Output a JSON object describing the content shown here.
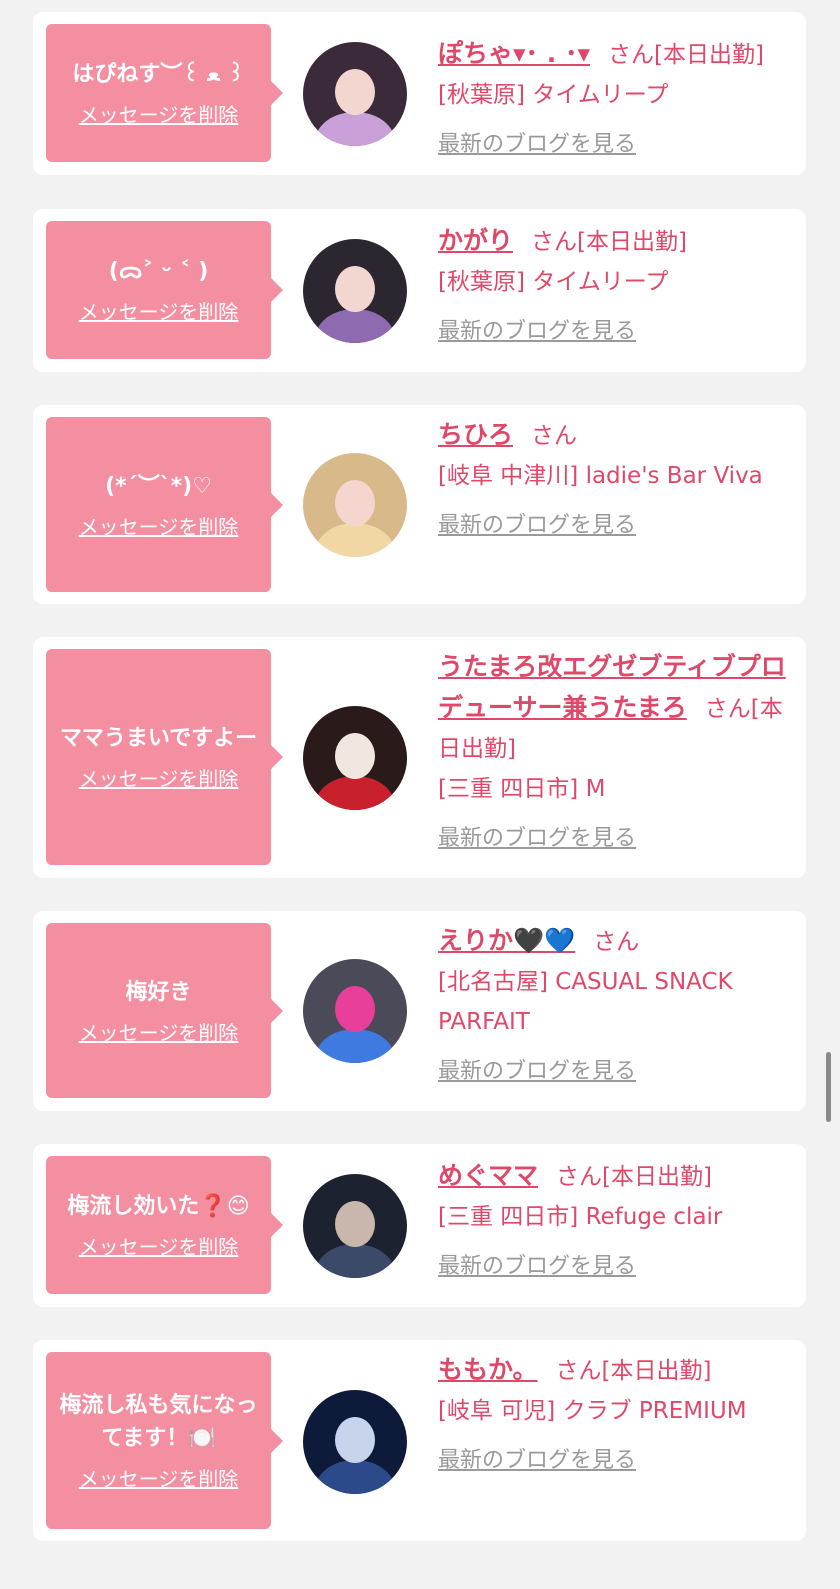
{
  "colors": {
    "page_background": "#f2f2f2",
    "card_background": "#ffffff",
    "bubble": "#f48fa1",
    "accent_text": "#e0486a",
    "blog_link": "#9a9a9a"
  },
  "delete_label": "メッセージを削除",
  "blog_label": "最新のブログを見る",
  "entries": [
    {
      "message": "はぴねす︶꒰ ﻌ ꒱",
      "name": "ぽちゃ▾･ . ･▾",
      "honorific": "さん[本日出勤]",
      "shop": "[秋葉原] タイムリープ",
      "avatar_icon": "girl-photo-icon",
      "avatar_colors": [
        "#3a2a3a",
        "#c9a0d8",
        "#f3d6d0"
      ]
    },
    {
      "message": "(ᯅ˃ ᵕ ˂ )",
      "name": "かがり",
      "honorific": "さん[本日出勤]",
      "shop": "[秋葉原] タイムリープ",
      "avatar_icon": "girl-photo-icon",
      "avatar_colors": [
        "#2c2630",
        "#8e6bb0",
        "#f1d7cf"
      ]
    },
    {
      "message": "(*´︶`*)♡",
      "name": "ちひろ",
      "honorific": "さん",
      "shop": "[岐阜 中津川] ladie's Bar Viva",
      "avatar_icon": "girl-photo-icon",
      "avatar_colors": [
        "#d8b98a",
        "#f0d7a4",
        "#f5d6cf"
      ]
    },
    {
      "message": "ママうまいですよー",
      "name": "うたまろ改エグゼブティブプロデューサー兼うたまろ",
      "honorific": "さん[本日出勤]",
      "shop": "[三重 四日市] M",
      "avatar_icon": "santa-photo-icon",
      "avatar_colors": [
        "#2a1a1a",
        "#c8202c",
        "#f0e8e0"
      ]
    },
    {
      "message": "梅好き",
      "name": "えりか🖤💙",
      "honorific": "さん",
      "shop": "[北名古屋] CASUAL SNACK PARFAIT",
      "avatar_icon": "heart-sticker-photo-icon",
      "avatar_colors": [
        "#4a4a58",
        "#3f7ae0",
        "#e8409a"
      ]
    },
    {
      "message": "梅流し効いた❓😊",
      "name": "めぐママ",
      "honorific": "さん[本日出勤]",
      "shop": "[三重 四日市] Refuge clair",
      "avatar_icon": "girl-photo-icon",
      "avatar_colors": [
        "#1c2230",
        "#3a4a68",
        "#c9b6ac"
      ]
    },
    {
      "message": "梅流し私も気になってます！🍽️",
      "name": "ももか。",
      "honorific": "さん[本日出勤]",
      "shop": "[岐阜 可児] クラブ PREMIUM",
      "avatar_icon": "night-scene-photo-icon",
      "avatar_colors": [
        "#0e1a3a",
        "#2c4a8a",
        "#c8d4ec"
      ]
    }
  ]
}
